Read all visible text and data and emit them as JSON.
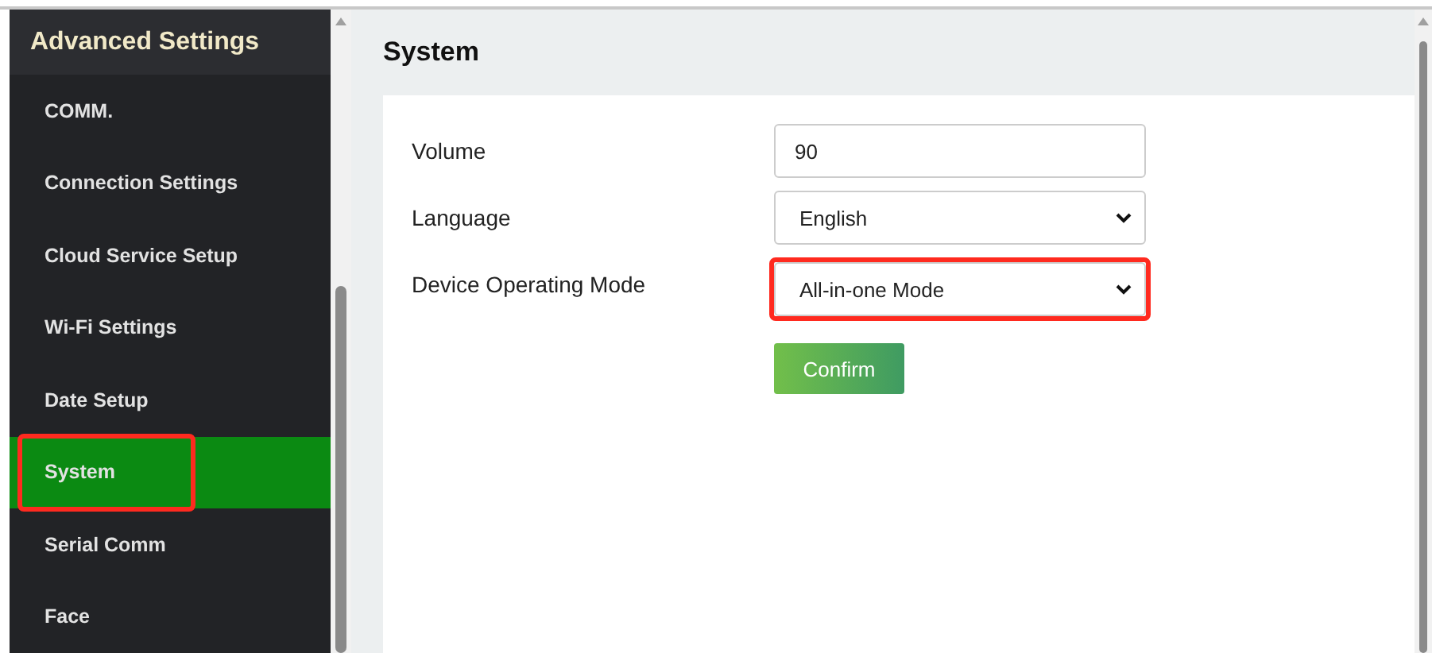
{
  "sidebar": {
    "title": "Advanced Settings",
    "items": [
      {
        "label": "COMM.",
        "selected": false,
        "highlighted": false
      },
      {
        "label": "Connection Settings",
        "selected": false,
        "highlighted": false
      },
      {
        "label": "Cloud Service Setup",
        "selected": false,
        "highlighted": false
      },
      {
        "label": "Wi-Fi Settings",
        "selected": false,
        "highlighted": false
      },
      {
        "label": "Date Setup",
        "selected": false,
        "highlighted": false
      },
      {
        "label": "System",
        "selected": true,
        "highlighted": true
      },
      {
        "label": "Serial Comm",
        "selected": false,
        "highlighted": false
      },
      {
        "label": "Face",
        "selected": false,
        "highlighted": false
      }
    ]
  },
  "page": {
    "title": "System",
    "fields": [
      {
        "kind": "input",
        "label": "Volume",
        "value": "90",
        "highlighted": false
      },
      {
        "kind": "select",
        "label": "Language",
        "value": "English",
        "highlighted": false
      },
      {
        "kind": "select",
        "label": "Device Operating Mode",
        "value": "All-in-one Mode",
        "highlighted": true
      }
    ],
    "button": "Confirm"
  }
}
